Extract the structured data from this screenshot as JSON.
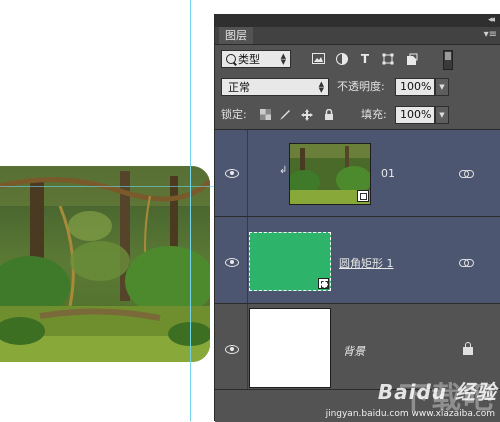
{
  "panel": {
    "tab_label": "图层",
    "collapse_glyph": "◂◂",
    "menu_glyph": "▾≡"
  },
  "filter_bar": {
    "filter_kind": "类型",
    "icons": [
      "image-filter-icon",
      "adjustment-filter-icon",
      "type-filter-icon",
      "shape-filter-icon",
      "smart-object-filter-icon"
    ]
  },
  "blend_bar": {
    "blend_mode": "正常",
    "opacity_label": "不透明度:",
    "opacity_value": "100%"
  },
  "lock_bar": {
    "lock_label": "锁定:",
    "fill_label": "填充:",
    "fill_value": "100%"
  },
  "layers": [
    {
      "name": "01",
      "type": "smart-object",
      "clipped": true,
      "selected": true
    },
    {
      "name": "圆角矩形 1",
      "type": "shape",
      "fill_color": "#2db36a",
      "selected": true
    },
    {
      "name": "背景",
      "type": "background",
      "locked": true,
      "selected": false
    }
  ],
  "watermark": {
    "logo_text": "Baidu 经验",
    "big_text": "下载吧",
    "url": "jingyan.baidu.com  www.xiazaiba.com"
  },
  "colors": {
    "panel_bg": "#535353",
    "selected_layer_bg": "#4c5670",
    "shape_fill": "#2db36a",
    "guide": "#74d3e8"
  }
}
